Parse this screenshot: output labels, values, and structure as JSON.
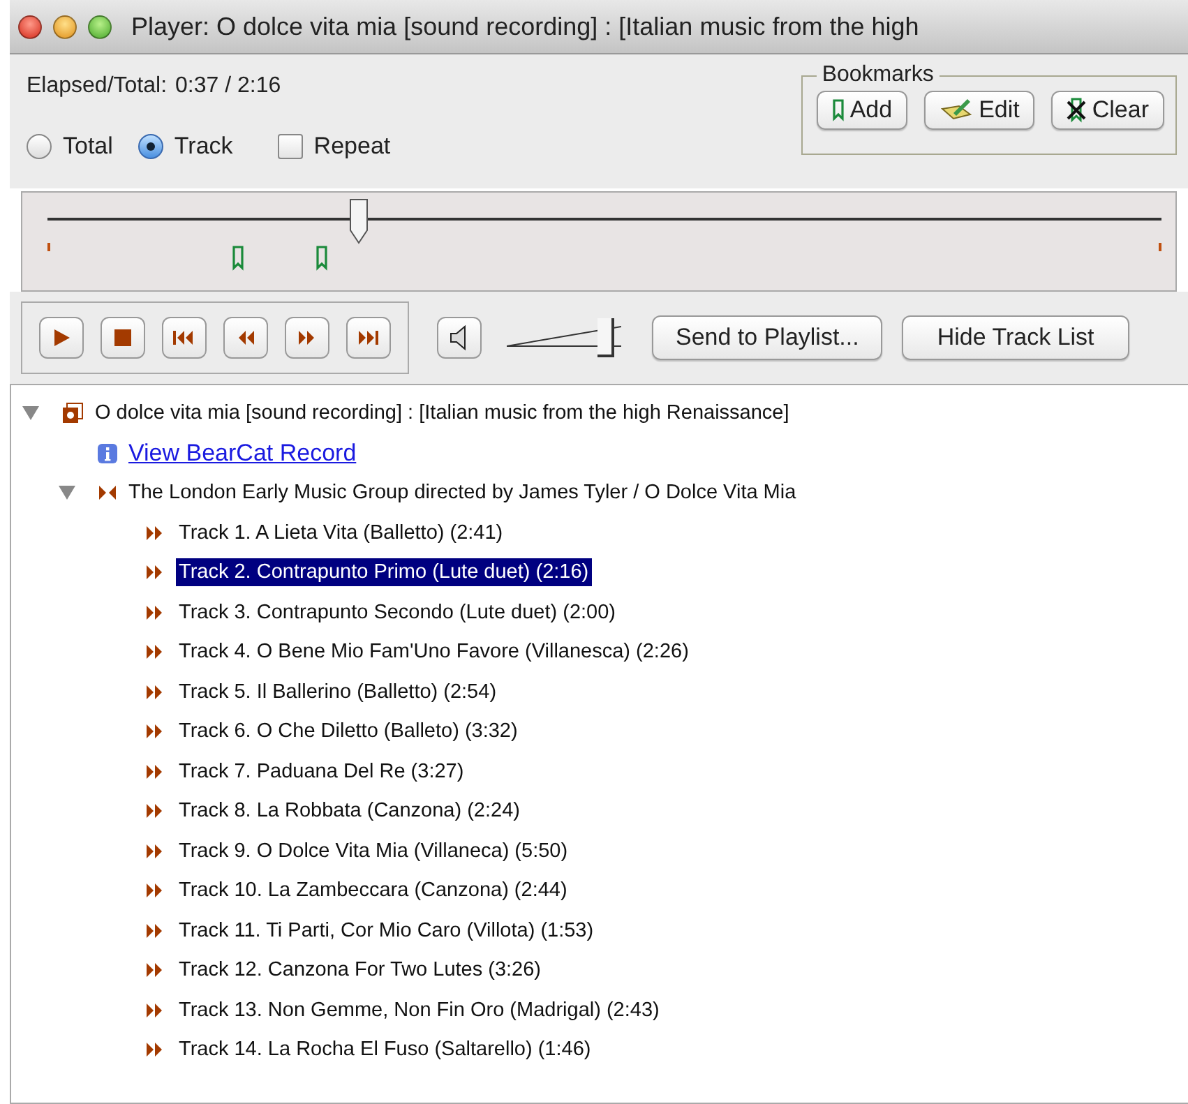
{
  "window": {
    "title": "Player: O dolce vita mia [sound recording] : [Italian music from the high"
  },
  "elapsed": {
    "label": "Elapsed/Total:",
    "value": "0:37 / 2:16"
  },
  "mode_options": [
    {
      "label": "Total",
      "selected": false
    },
    {
      "label": "Track",
      "selected": true
    }
  ],
  "repeat": {
    "label": "Repeat",
    "checked": false
  },
  "bookmarks": {
    "title": "Bookmarks",
    "buttons": [
      {
        "kind": "add",
        "label": "Add"
      },
      {
        "kind": "edit",
        "label": "Edit"
      },
      {
        "kind": "clear",
        "label": "Clear"
      }
    ]
  },
  "seek": {
    "level": 0.28,
    "markers": [
      {
        "level": 0.17
      },
      {
        "level": 0.245
      }
    ]
  },
  "transport": [
    {
      "kind": "play"
    },
    {
      "kind": "stop"
    },
    {
      "kind": "first"
    },
    {
      "kind": "back"
    },
    {
      "kind": "forward"
    },
    {
      "kind": "last"
    }
  ],
  "volume": {
    "level": 0.88
  },
  "actions": [
    "Send to Playlist...",
    "Hide Track List"
  ],
  "tree": {
    "label": "O dolce vita mia [sound recording] : [Italian music from the high Renaissance]",
    "expanded": true,
    "children": [
      {
        "kind": "link",
        "label": "View BearCat Record"
      },
      {
        "kind": "group",
        "label": "The London Early Music Group directed by James Tyler / O Dolce Vita Mia",
        "expanded": true,
        "children": [
          {
            "label": "Track 1. A Lieta Vita (Balletto) (2:41)",
            "selected": false
          },
          {
            "label": "Track 2. Contrapunto Primo (Lute duet) (2:16)",
            "selected": true
          },
          {
            "label": "Track 3. Contrapunto Secondo (Lute duet) (2:00)",
            "selected": false
          },
          {
            "label": "Track 4. O Bene Mio Fam'Uno Favore (Villanesca) (2:26)",
            "selected": false
          },
          {
            "label": "Track 5. Il Ballerino (Balletto) (2:54)",
            "selected": false
          },
          {
            "label": "Track 6. O Che Diletto (Balleto) (3:32)",
            "selected": false
          },
          {
            "label": "Track 7. Paduana Del Re (3:27)",
            "selected": false
          },
          {
            "label": "Track 8. La Robbata (Canzona) (2:24)",
            "selected": false
          },
          {
            "label": "Track 9. O Dolce Vita Mia (Villaneca) (5:50)",
            "selected": false
          },
          {
            "label": "Track 10. La Zambeccara (Canzona) (2:44)",
            "selected": false
          },
          {
            "label": "Track 11. Ti Parti, Cor Mio Caro (Villota) (1:53)",
            "selected": false
          },
          {
            "label": "Track 12. Canzona For Two Lutes (3:26)",
            "selected": false
          },
          {
            "label": "Track 13. Non Gemme, Non Fin Oro (Madrigal) (2:43)",
            "selected": false
          },
          {
            "label": "Track 14. La Rocha El Fuso (Saltarello) (1:46)",
            "selected": false
          }
        ]
      }
    ]
  }
}
